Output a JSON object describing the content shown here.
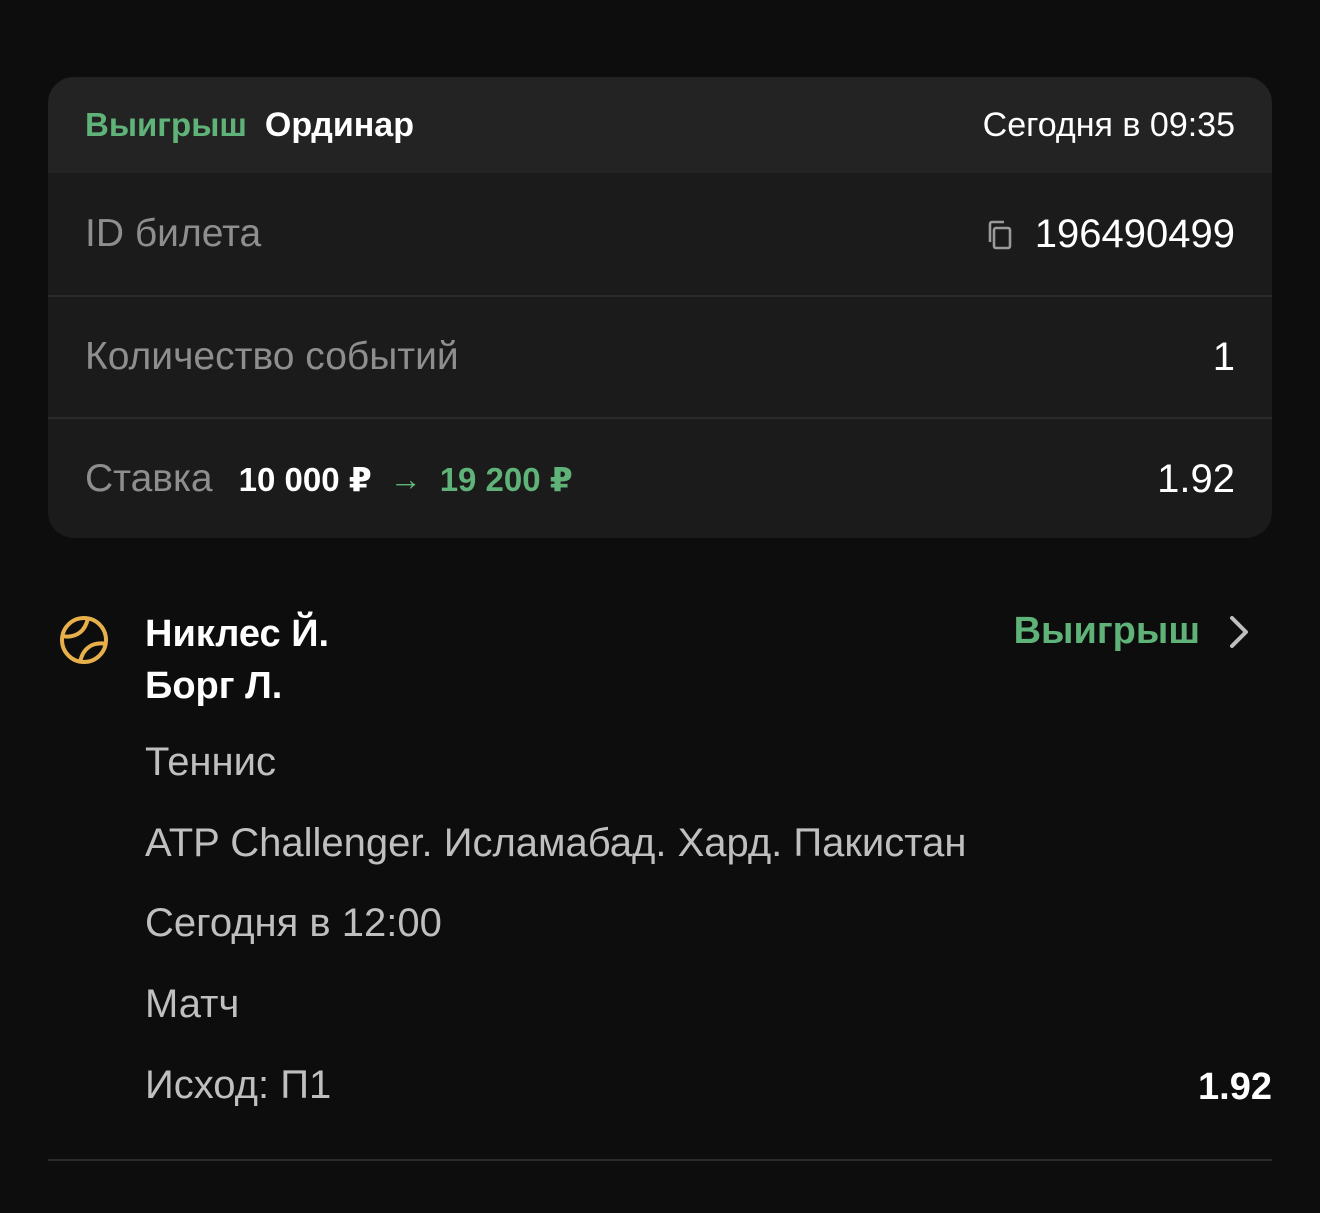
{
  "ticket": {
    "status": "Выигрыш",
    "type": "Ординар",
    "date": "Сегодня в 09:35",
    "id_label": "ID билета",
    "id_value": "196490499",
    "events_label": "Количество событий",
    "events_value": "1",
    "stake_label": "Ставка",
    "stake_amount": "10 000 ₽",
    "stake_arrow": "→",
    "stake_win": "19 200 ₽",
    "total_odds": "1.92"
  },
  "event": {
    "player1": "Никлес Й.",
    "player2": "Борг Л.",
    "result": "Выигрыш",
    "sport": "Теннис",
    "tournament": "ATP Challenger. Исламабад. Хард. Пакистан",
    "start_time": "Сегодня в 12:00",
    "market": "Матч",
    "outcome": "Исход: П1",
    "odds": "1.92"
  },
  "colors": {
    "background": "#0d0d0d",
    "card": "#1b1b1b",
    "accent_green": "#5fb378",
    "tennis_icon": "#e8b04a"
  },
  "icons": {
    "copy": "copy-icon",
    "sport": "tennis-ball-icon",
    "chevron": "chevron-right-icon"
  }
}
